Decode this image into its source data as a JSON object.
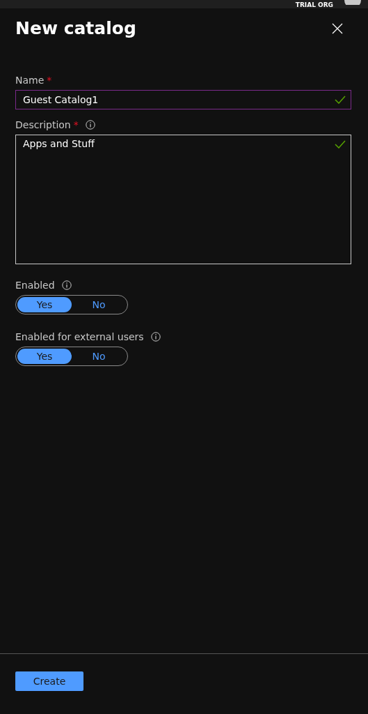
{
  "top_bar": {
    "org": "TRIAL ORG"
  },
  "panel": {
    "title": "New catalog"
  },
  "name_field": {
    "label": "Name",
    "required_mark": "*",
    "value": "Guest Catalog1",
    "valid": true,
    "focused": true
  },
  "description_field": {
    "label": "Description",
    "required_mark": "*",
    "info": true,
    "value": "Apps and Stuff",
    "valid": true
  },
  "toggles": [
    {
      "label": "Enabled",
      "options": [
        {
          "label": "Yes",
          "selected": true
        },
        {
          "label": "No",
          "selected": false
        }
      ]
    },
    {
      "label": "Enabled for external users",
      "options": [
        {
          "label": "Yes",
          "selected": true
        },
        {
          "label": "No",
          "selected": false
        }
      ]
    }
  ],
  "buttons": [
    {
      "label": "Create"
    }
  ]
}
